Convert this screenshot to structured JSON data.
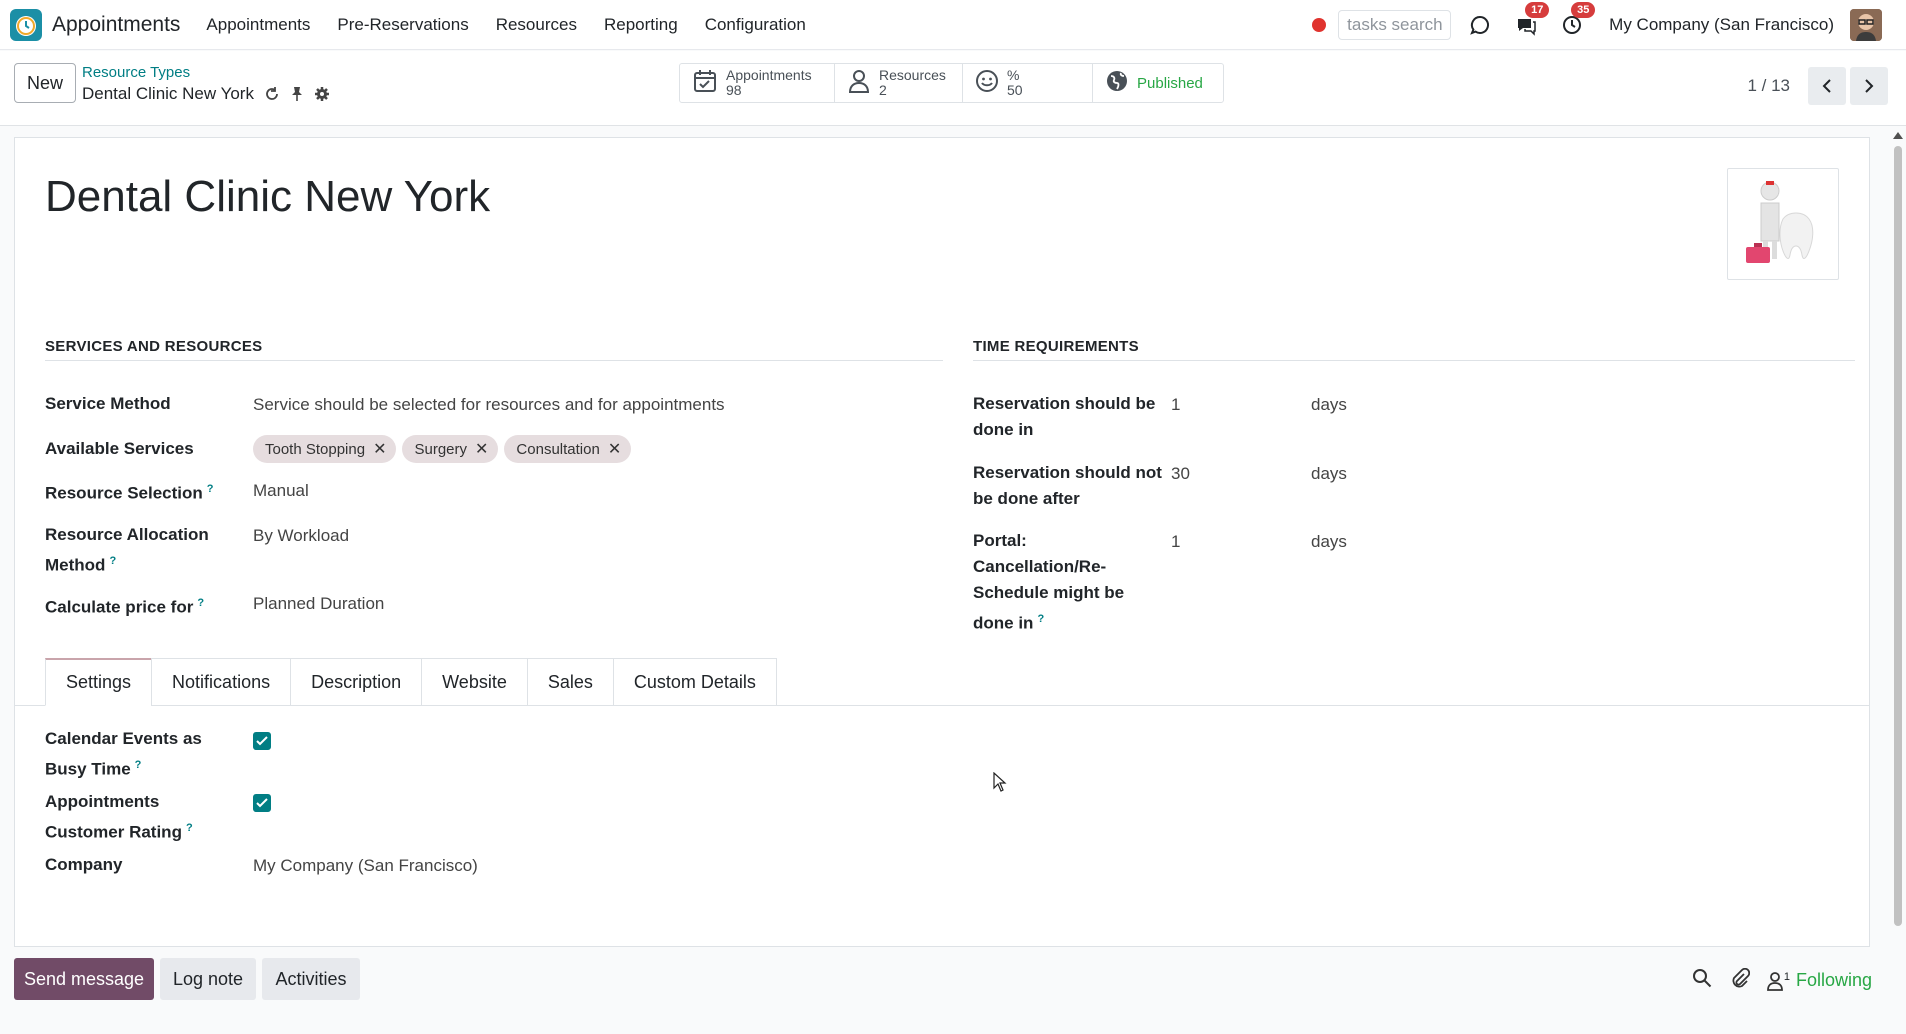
{
  "navbar": {
    "app_name": "Appointments",
    "menu": [
      "Appointments",
      "Pre-Reservations",
      "Resources",
      "Reporting",
      "Configuration"
    ],
    "search_placeholder": "tasks search",
    "messages_badge": "17",
    "activities_badge": "35",
    "company": "My Company (San Francisco)"
  },
  "control": {
    "new_label": "New",
    "breadcrumb_parent": "Resource Types",
    "breadcrumb_current": "Dental Clinic New York",
    "smart_buttons": [
      {
        "label": "Appointments",
        "value": "98",
        "icon": "calendar-check-icon"
      },
      {
        "label": "Resources",
        "value": "2",
        "icon": "user-icon"
      },
      {
        "label": "%",
        "value": "50",
        "icon": "smile-icon"
      },
      {
        "label": "Published",
        "value": "",
        "icon": "globe-icon"
      }
    ],
    "pager": "1 / 13"
  },
  "form": {
    "title": "Dental Clinic New York",
    "services_header": "SERVICES AND RESOURCES",
    "time_header": "TIME REQUIREMENTS",
    "service_method_label": "Service Method",
    "service_method_value": "Service should be selected for resources and for appointments",
    "available_services_label": "Available Services",
    "services": [
      "Tooth Stopping",
      "Surgery",
      "Consultation"
    ],
    "resource_selection_label": "Resource Selection",
    "resource_selection_value": "Manual",
    "allocation_label_1": "Resource Allocation",
    "allocation_label_2": "Method",
    "allocation_value": "By Workload",
    "price_label": "Calculate price for",
    "price_value": "Planned Duration",
    "reservation_in_label_1": "Reservation should be",
    "reservation_in_label_2": "done in",
    "reservation_in_value": "1",
    "reservation_in_unit": "days",
    "reservation_after_label_1": "Reservation should not",
    "reservation_after_label_2": "be done after",
    "reservation_after_value": "30",
    "reservation_after_unit": "days",
    "portal_label_1": "Portal:",
    "portal_label_2": "Cancellation/Re-",
    "portal_label_3": "Schedule might be",
    "portal_label_4": "done in",
    "portal_value": "1",
    "portal_unit": "days"
  },
  "tabs": [
    "Settings",
    "Notifications",
    "Description",
    "Website",
    "Sales",
    "Custom Details"
  ],
  "settings": {
    "calendar_label_1": "Calendar Events as",
    "calendar_label_2": "Busy Time",
    "calendar_checked": true,
    "rating_label_1": "Appointments",
    "rating_label_2": "Customer Rating",
    "rating_checked": true,
    "company_label": "Company",
    "company_value": "My Company (San Francisco)"
  },
  "chatter": {
    "send_message": "Send message",
    "log_note": "Log note",
    "activities": "Activities",
    "followers_count": "1",
    "following": "Following"
  },
  "colors": {
    "brand": "#714b67",
    "accent": "#017e84",
    "badge": "#d63c3c"
  }
}
